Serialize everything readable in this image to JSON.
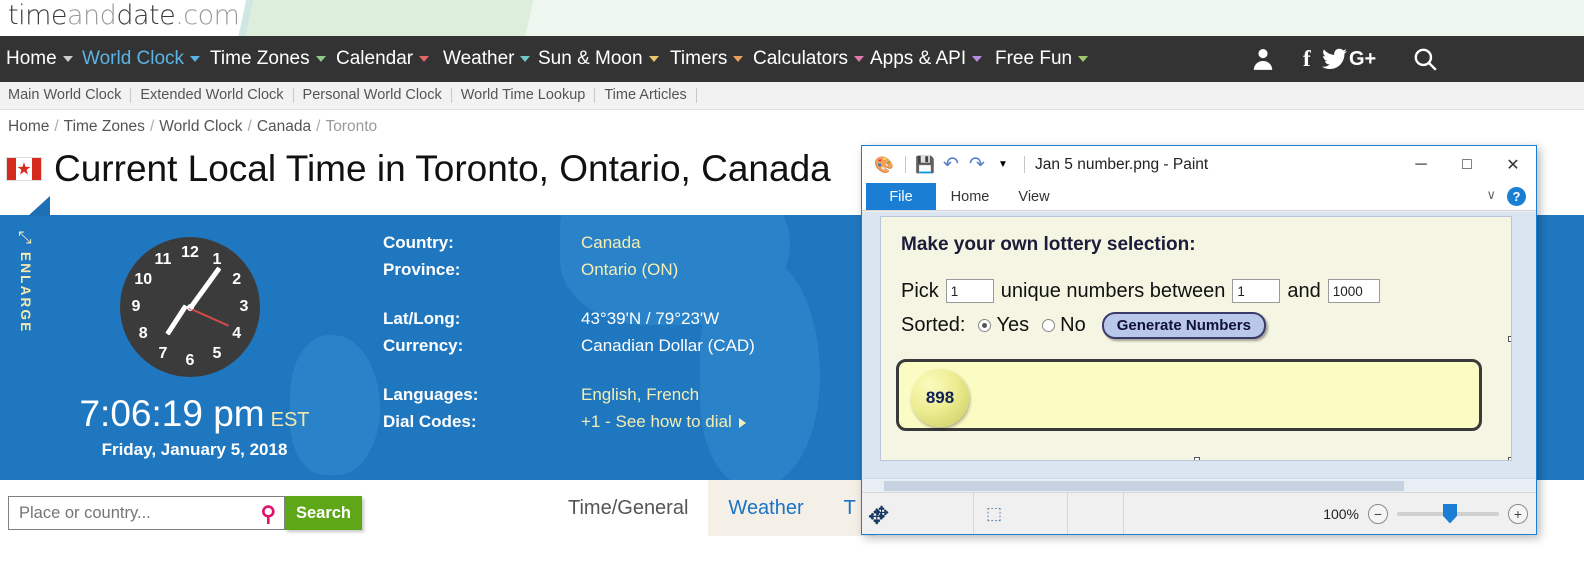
{
  "site": {
    "logo": {
      "part1": "time",
      "part2": "and",
      "part3": "date",
      "part4": ".com"
    },
    "nav": [
      {
        "label": "Home",
        "has_caret": true,
        "caret_color": "#cccccc",
        "active": false
      },
      {
        "label": "World Clock",
        "has_caret": true,
        "caret_color": "#5bb3e4",
        "active": true
      },
      {
        "label": "Time Zones",
        "has_caret": true,
        "caret_color": "#8fc98f",
        "active": false
      },
      {
        "label": "Calendar",
        "has_caret": true,
        "caret_color": "#e06666",
        "active": false
      },
      {
        "label": "Weather",
        "has_caret": true,
        "caret_color": "#6fc9c9",
        "active": false
      },
      {
        "label": "Sun & Moon",
        "has_caret": true,
        "caret_color": "#e8c46a",
        "active": false
      },
      {
        "label": "Timers",
        "has_caret": true,
        "caret_color": "#e8a05a",
        "active": false
      },
      {
        "label": "Calculators",
        "has_caret": true,
        "caret_color": "#e07aa8",
        "active": false
      },
      {
        "label": "Apps & API",
        "has_caret": true,
        "caret_color": "#b48ce0",
        "active": false
      },
      {
        "label": "Free Fun",
        "has_caret": true,
        "caret_color": "#9ac96a",
        "active": false
      }
    ],
    "nav_icons": [
      {
        "name": "account-icon",
        "glyph": "A"
      },
      {
        "name": "facebook-icon",
        "glyph": "f"
      },
      {
        "name": "twitter-icon",
        "glyph": "t"
      },
      {
        "name": "googleplus-icon",
        "glyph": "G+"
      },
      {
        "name": "search-icon",
        "glyph": "⌕"
      }
    ],
    "sub_nav": [
      "Main World Clock",
      "Extended World Clock",
      "Personal World Clock",
      "World Time Lookup",
      "Time Articles"
    ],
    "breadcrumb": [
      "Home",
      "Time Zones",
      "World Clock",
      "Canada",
      "Toronto"
    ],
    "page_title": "Current Local Time in Toronto, Ontario, Canada",
    "flag_alt": "Canada flag",
    "enlarge_label": "ENLARGE",
    "clock": {
      "numbers": [
        "12",
        "1",
        "2",
        "3",
        "4",
        "5",
        "6",
        "7",
        "8",
        "9",
        "10",
        "11"
      ],
      "time": "7:06:19 pm",
      "timezone": "EST",
      "date": "Friday, January 5, 2018"
    },
    "info": [
      {
        "label": "Country:",
        "value": "Canada",
        "style": "yellow"
      },
      {
        "label": "Province:",
        "value": "Ontario (ON)",
        "style": "yellow"
      },
      {
        "label": "Lat/Long:",
        "value": "43°39'N / 79°23'W",
        "style": "white"
      },
      {
        "label": "Currency:",
        "value": "Canadian Dollar (CAD)",
        "style": "white"
      },
      {
        "label": "Languages:",
        "value": "English, French",
        "style": "yellow"
      },
      {
        "label": "Dial Codes:",
        "value": "+1 - See how to dial",
        "style": "yellow",
        "has_arrow": true
      }
    ],
    "search": {
      "placeholder": "Place or country...",
      "value": "",
      "button": "Search"
    },
    "tabs": [
      {
        "label": "Time/General",
        "active": true
      },
      {
        "label": "Weather",
        "active": false
      },
      {
        "label": "T",
        "active": false
      }
    ],
    "colors": {
      "nav_bg": "#333333",
      "panel_blue": "#1f77c0",
      "accent_green": "#5ea818",
      "link_blue": "#1a73c4",
      "yellow_text": "#f4eeb4"
    }
  },
  "paint": {
    "title": "Jan 5 number.png - Paint",
    "quick_access": [
      {
        "name": "paint-app-icon",
        "glyph": "🎨"
      },
      {
        "name": "save-icon",
        "glyph": "💾"
      },
      {
        "name": "undo-icon",
        "glyph": "↶"
      },
      {
        "name": "redo-icon",
        "glyph": "↷"
      },
      {
        "name": "customize-qat-icon",
        "glyph": "▾"
      }
    ],
    "window_buttons": [
      {
        "name": "minimize-button",
        "glyph": "─"
      },
      {
        "name": "maximize-button",
        "glyph": "□"
      },
      {
        "name": "close-button",
        "glyph": "✕"
      }
    ],
    "ribbon_tabs": [
      {
        "label": "File",
        "active": true
      },
      {
        "label": "Home",
        "active": false
      },
      {
        "label": "View",
        "active": false
      }
    ],
    "ribbon_collapse_icon": "∨",
    "help_label": "?",
    "status": {
      "move_tool_icon": "✥",
      "selection_icon": "⬚",
      "zoom_label": "100%",
      "zoom_out": "−",
      "zoom_in": "+"
    }
  },
  "lottery": {
    "heading": "Make your own lottery selection:",
    "pick_label": "Pick",
    "pick_value": "1",
    "unique_label": "unique numbers between",
    "min_value": "1",
    "and_label": "and",
    "max_value": "1000",
    "sorted_label": "Sorted:",
    "sorted_yes": "Yes",
    "sorted_no": "No",
    "sorted_selected": "Yes",
    "generate_button": "Generate Numbers",
    "results": [
      "898"
    ]
  }
}
